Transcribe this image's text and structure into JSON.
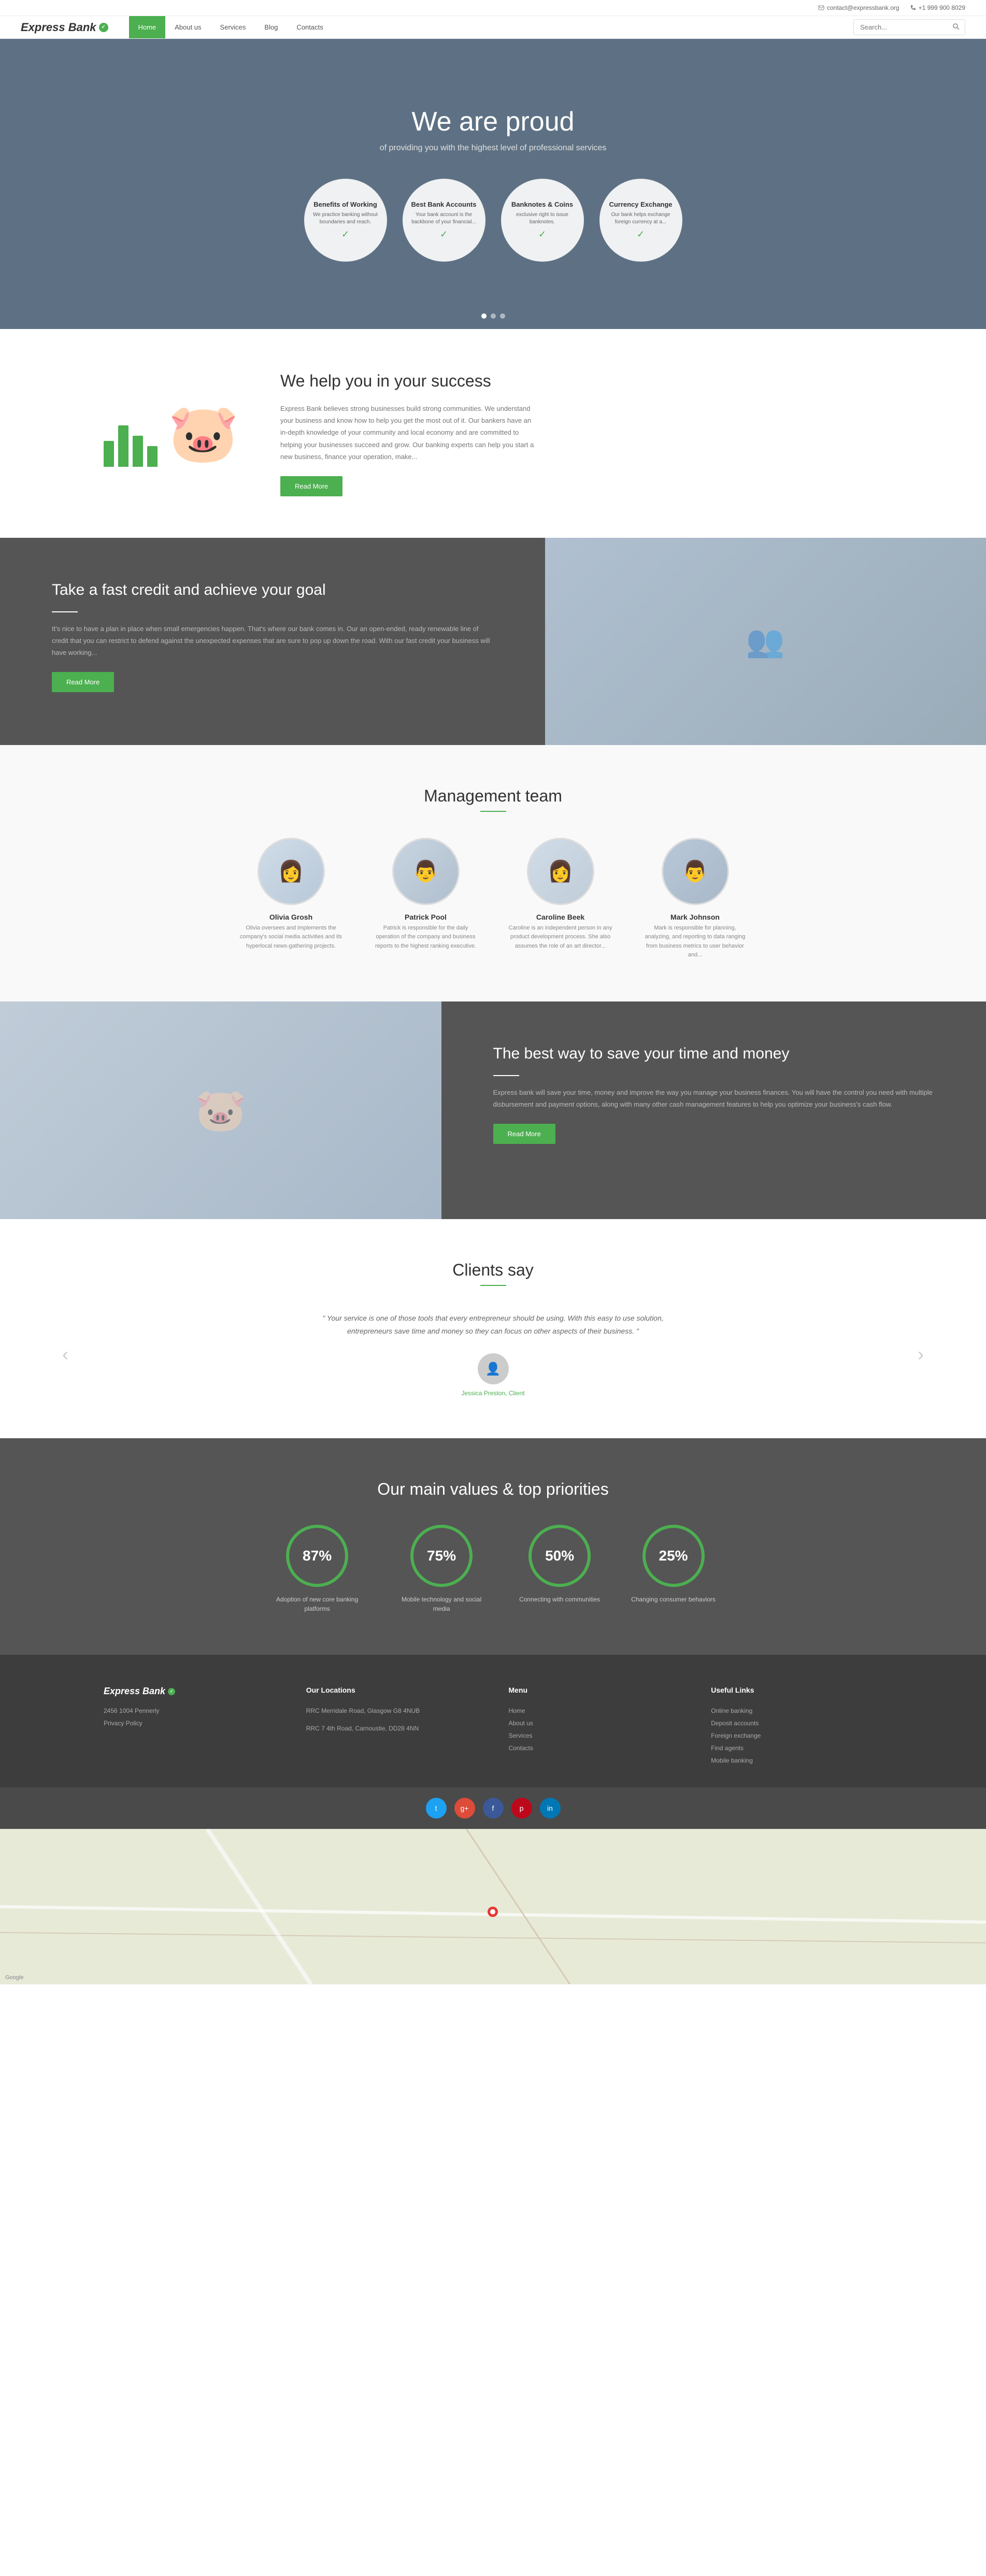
{
  "site": {
    "name": "Express Bank",
    "tagline": "Express Bank"
  },
  "topbar": {
    "email": "contact@expressbank.org",
    "phone": "+1 999 900 8029"
  },
  "nav": {
    "items": [
      {
        "label": "Home",
        "active": true
      },
      {
        "label": "About us",
        "active": false
      },
      {
        "label": "Services",
        "active": false
      },
      {
        "label": "Blog",
        "active": false
      },
      {
        "label": "Contacts",
        "active": false
      }
    ],
    "search_placeholder": "Search..."
  },
  "hero": {
    "title": "We are proud",
    "subtitle": "of providing you with the highest level of professional services",
    "cards": [
      {
        "title": "Benefits of Working",
        "desc": "We practice banking without boundaries and reach."
      },
      {
        "title": "Best Bank Accounts",
        "desc": "Your bank account is the backbone of your financial..."
      },
      {
        "title": "Banknotes & Coins",
        "desc": "exclusive right to issue banknotes."
      },
      {
        "title": "Currency Exchange",
        "desc": "Our bank helps exchange foreign currency at a..."
      }
    ]
  },
  "we_help": {
    "title": "We help you in your success",
    "body": "Express Bank believes strong businesses build strong communities. We understand your business and know how to help you get the most out of it. Our bankers have an in-depth knowledge of your community and local economy and are committed to helping your businesses succeed and grow. Our banking experts can help you start a new business, finance your operation, make...",
    "button": "Read More"
  },
  "fast_credit": {
    "title": "Take a fast credit and achieve your goal",
    "body": "It's nice to have a plan in place when small emergencies happen. That's where our bank comes in. Our an open-ended, ready renewable line of credit that you can restrict to defend against the unexpected expenses that are sure to pop up down the road. With our fast credit your business will have working...",
    "button": "Read More"
  },
  "management": {
    "title": "Management team",
    "members": [
      {
        "name": "Olivia Grosh",
        "desc": "Olivia oversees and implements the company's social media activities and its hyperlocal news-gathering projects."
      },
      {
        "name": "Patrick Pool",
        "desc": "Patrick is responsible for the daily operation of the company and business reports to the highest ranking executive."
      },
      {
        "name": "Caroline Beek",
        "desc": "Caroline is an independent person in any product development process. She also assumes the role of an art director..."
      },
      {
        "name": "Mark Johnson",
        "desc": "Mark is responsible for planning, analyzing, and reporting to data ranging from business metrics to user behavior and..."
      }
    ]
  },
  "save_time": {
    "title": "The best way to save your time and money",
    "body": "Express bank will save your time, money and improve the way you manage your business finances. You will have the control you need with multiple disbursement and payment options, along with many other cash management features to help you optimize your business's cash flow.",
    "button": "Read More"
  },
  "clients": {
    "title": "Clients say",
    "quote": "\" Your service is one of those tools that every entrepreneur should be using. With this easy to use solution, entrepreneurs save time and money so they can focus on other aspects of their business. \"",
    "author_name": "Jessica Preston, Client",
    "nav_prev": "‹",
    "nav_next": "›"
  },
  "values": {
    "title": "Our main values & top priorities",
    "items": [
      {
        "percent": "87%",
        "label": "Adoption of new core banking platforms",
        "class": "p87"
      },
      {
        "percent": "75%",
        "label": "Mobile technology and social media",
        "class": "p75"
      },
      {
        "percent": "50%",
        "label": "Connecting with communities",
        "class": "p50"
      },
      {
        "percent": "25%",
        "label": "Changing consumer behaviors",
        "class": "p25"
      }
    ]
  },
  "footer": {
    "logo": "Express Bank",
    "address_line1": "2456 1004 Pennerly",
    "address_link1": "Privacy Policy",
    "locations_title": "Our Locations",
    "locations": [
      "RRC Merridale Road, Glasgow G8 4NUB",
      "RRC 7 4th Road, Carnoustie, DD28 4NN"
    ],
    "menu_title": "Menu",
    "menu_items": [
      "Home",
      "About us",
      "Services",
      "Contacts"
    ],
    "links_title": "Useful Links",
    "links": [
      "Online banking",
      "Deposit accounts",
      "Foreign exchange",
      "Find agents",
      "Mobile banking"
    ]
  },
  "social": {
    "twitter": "t",
    "google": "g+",
    "facebook": "f",
    "pinterest": "p",
    "linkedin": "in"
  }
}
